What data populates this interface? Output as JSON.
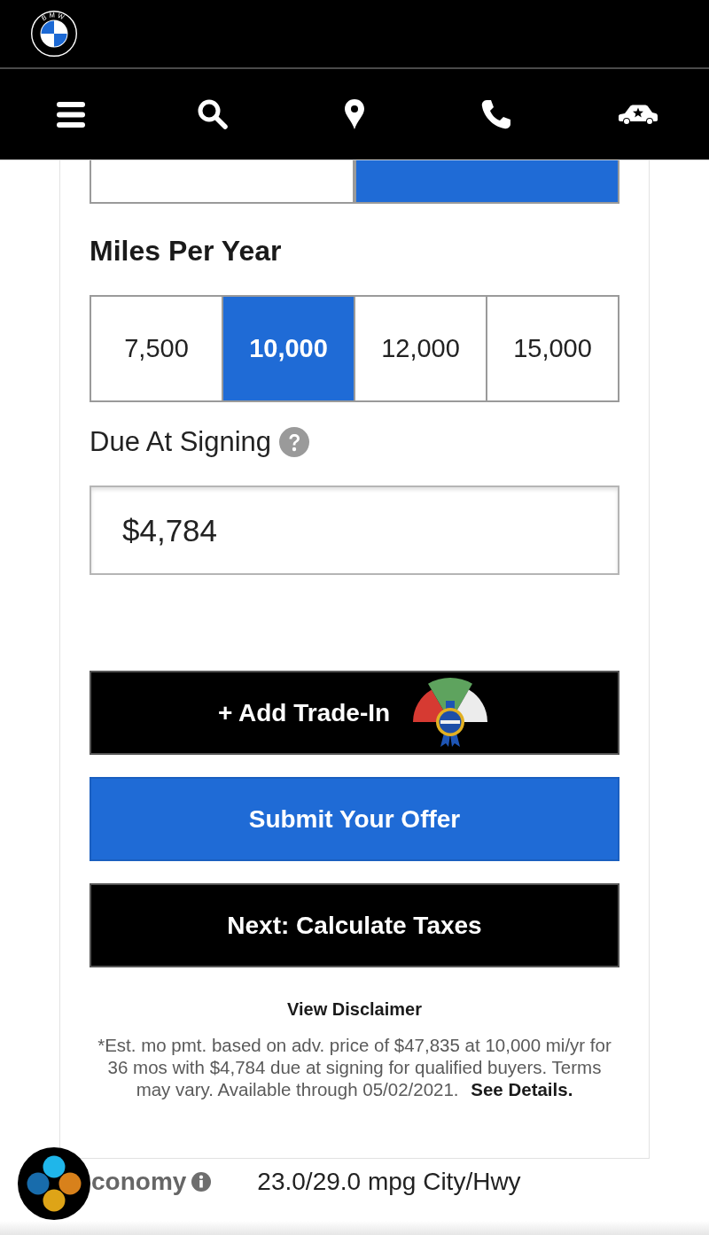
{
  "brand": {
    "logo_text": "BMW"
  },
  "term_options": [
    {
      "selected": false
    },
    {
      "selected": true
    }
  ],
  "miles_per_year": {
    "heading": "Miles Per Year",
    "options": [
      {
        "label": "7,500",
        "selected": false
      },
      {
        "label": "10,000",
        "selected": true
      },
      {
        "label": "12,000",
        "selected": false
      },
      {
        "label": "15,000",
        "selected": false
      }
    ]
  },
  "due_at_signing": {
    "label": "Due At Signing",
    "value": "$4,784"
  },
  "buttons": [
    {
      "kind": "trade_in",
      "label": "+ Add Trade-In"
    },
    {
      "kind": "primary",
      "label": "Submit Your Offer"
    },
    {
      "kind": "dark",
      "label": "Next: Calculate Taxes"
    }
  ],
  "disclaimer": {
    "link": "View Disclaimer",
    "text": "*Est. mo pmt. based on adv. price of $47,835 at 10,000 mi/yr for 36 mos with $4,784 due at signing for qualified buyers. Terms may vary. Available through 05/02/2021.",
    "details_link": "See Details."
  },
  "specs": [
    {
      "label": "conomy",
      "value": "23.0/29.0 mpg City/Hwy"
    }
  ]
}
